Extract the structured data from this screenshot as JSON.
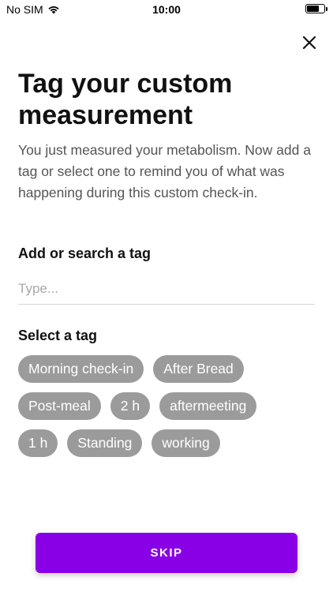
{
  "status_bar": {
    "carrier": "No SIM",
    "time": "10:00",
    "battery_level": 0.75,
    "icons": [
      "wifi-icon",
      "battery-icon"
    ]
  },
  "header": {
    "close_icon": "close-icon",
    "title": "Tag your custom measurement",
    "description": "You just measured your metabolism. Now add a tag or select one to remind you of what was happening during this custom check-in."
  },
  "add_tag": {
    "label": "Add or search a tag",
    "placeholder": "Type...",
    "value": ""
  },
  "select_tag": {
    "label": "Select a tag",
    "rows": [
      [
        "Morning check-in",
        "After Bread"
      ],
      [
        "Post-meal",
        "2 h",
        "aftermeeting"
      ],
      [
        "1 h",
        "Standing",
        "working"
      ]
    ]
  },
  "actions": {
    "skip_label": "SKIP"
  },
  "colors": {
    "accent": "#8a00e6",
    "chip_bg": "#9b9b9b",
    "text": "#111111",
    "muted_text": "#555555",
    "placeholder": "#a8a8a8"
  }
}
